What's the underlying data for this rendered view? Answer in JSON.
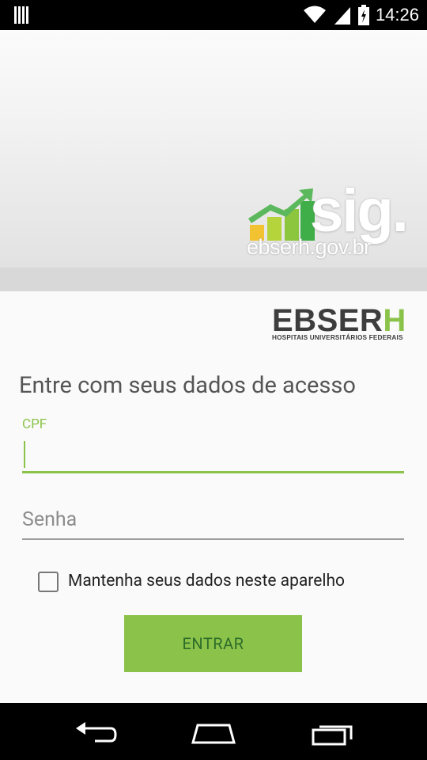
{
  "status_bar": {
    "time": "14:26"
  },
  "banner": {
    "logo_text": "sig.",
    "logo_url": "ebserh.gov.br"
  },
  "brand": {
    "name_main": "EBSER",
    "name_accent": "H",
    "tagline": "HOSPITAIS UNIVERSITÁRIOS FEDERAIS"
  },
  "login": {
    "prompt": "Entre com seus dados de acesso",
    "cpf_label": "CPF",
    "cpf_value": "",
    "password_placeholder": "Senha",
    "remember_label": "Mantenha seus dados neste aparelho",
    "remember_checked": false,
    "submit_label": "ENTRAR"
  },
  "colors": {
    "accent": "#8bc34a",
    "button_text": "#2e6d2a"
  },
  "icons": [
    "menu-grid-icon",
    "wifi-icon",
    "signal-icon",
    "battery-icon",
    "back-icon",
    "home-icon",
    "recent-apps-icon"
  ]
}
